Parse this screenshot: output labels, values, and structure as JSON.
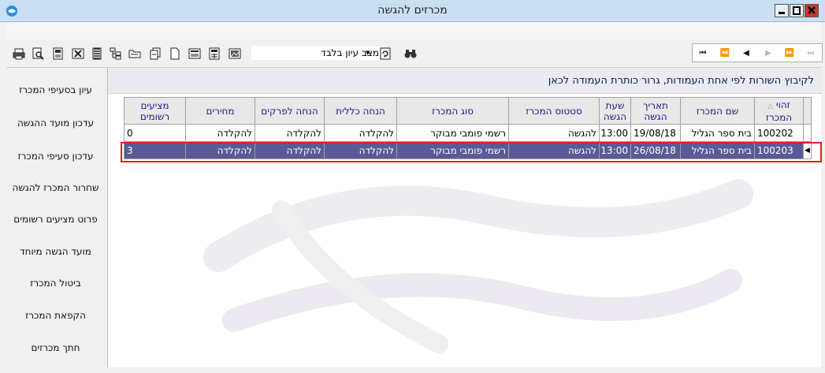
{
  "window": {
    "title": "מכרזים להגשה"
  },
  "toolbar": {
    "icons": [
      "print-icon",
      "print-preview-icon",
      "export-icon",
      "excel-icon",
      "columns-icon",
      "tree-icon",
      "folder-icon",
      "copy-icon",
      "new-document-icon",
      "form-icon",
      "calculator-icon",
      "image-icon",
      "refresh-icon",
      "binoculars-icon"
    ],
    "mode_label": "מצב עיון בלבד"
  },
  "nav": [
    "first",
    "previous-page",
    "previous",
    "next",
    "next-page",
    "last"
  ],
  "sidebar": {
    "items": [
      {
        "label": "עיון בסעיפי המכרז"
      },
      {
        "label": "עדכון מועד ההגשה"
      },
      {
        "label": "עדכון סעיפי המכרז"
      },
      {
        "label": "שחרור המכרז להגשה"
      },
      {
        "label": "פרוט מציעים רשומים"
      },
      {
        "label": "מועד הגשה מיוחד"
      },
      {
        "label": "ביטול המכרז"
      },
      {
        "label": "הקפאת המכרז"
      },
      {
        "label": "חתך מכרזים"
      }
    ]
  },
  "group_panel": {
    "text": "לקיבוץ השורות לפי אחת העמודות, גרור כותרת העמודה לכאן"
  },
  "grid": {
    "headers": [
      {
        "l1": "זהוי",
        "l2": "המכרז"
      },
      {
        "l1": "שם המכרז",
        "l2": ""
      },
      {
        "l1": "תאריך",
        "l2": "הגשה"
      },
      {
        "l1": "שעת",
        "l2": "הגשה"
      },
      {
        "l1": "סטטוס המכרז",
        "l2": ""
      },
      {
        "l1": "סוג המכרז",
        "l2": ""
      },
      {
        "l1": "הנחה כללית",
        "l2": ""
      },
      {
        "l1": "הנחה לפרקים",
        "l2": ""
      },
      {
        "l1": "מחירים",
        "l2": ""
      },
      {
        "l1": "מציעים",
        "l2": "רשומים"
      }
    ],
    "rows": [
      [
        "100202",
        "בית ספר הגליל",
        "19/08/18",
        "13:00",
        "להגשה",
        "רשמי פומבי מבוקר",
        "להקלדה",
        "להקלדה",
        "להקלדה",
        "0"
      ],
      [
        "100203",
        "בית ספר הגליל",
        "26/08/18",
        "13:00",
        "להגשה",
        "רשמי פומבי מבוקר",
        "להקלדה",
        "להקלדה",
        "להקלדה",
        "3"
      ]
    ]
  }
}
